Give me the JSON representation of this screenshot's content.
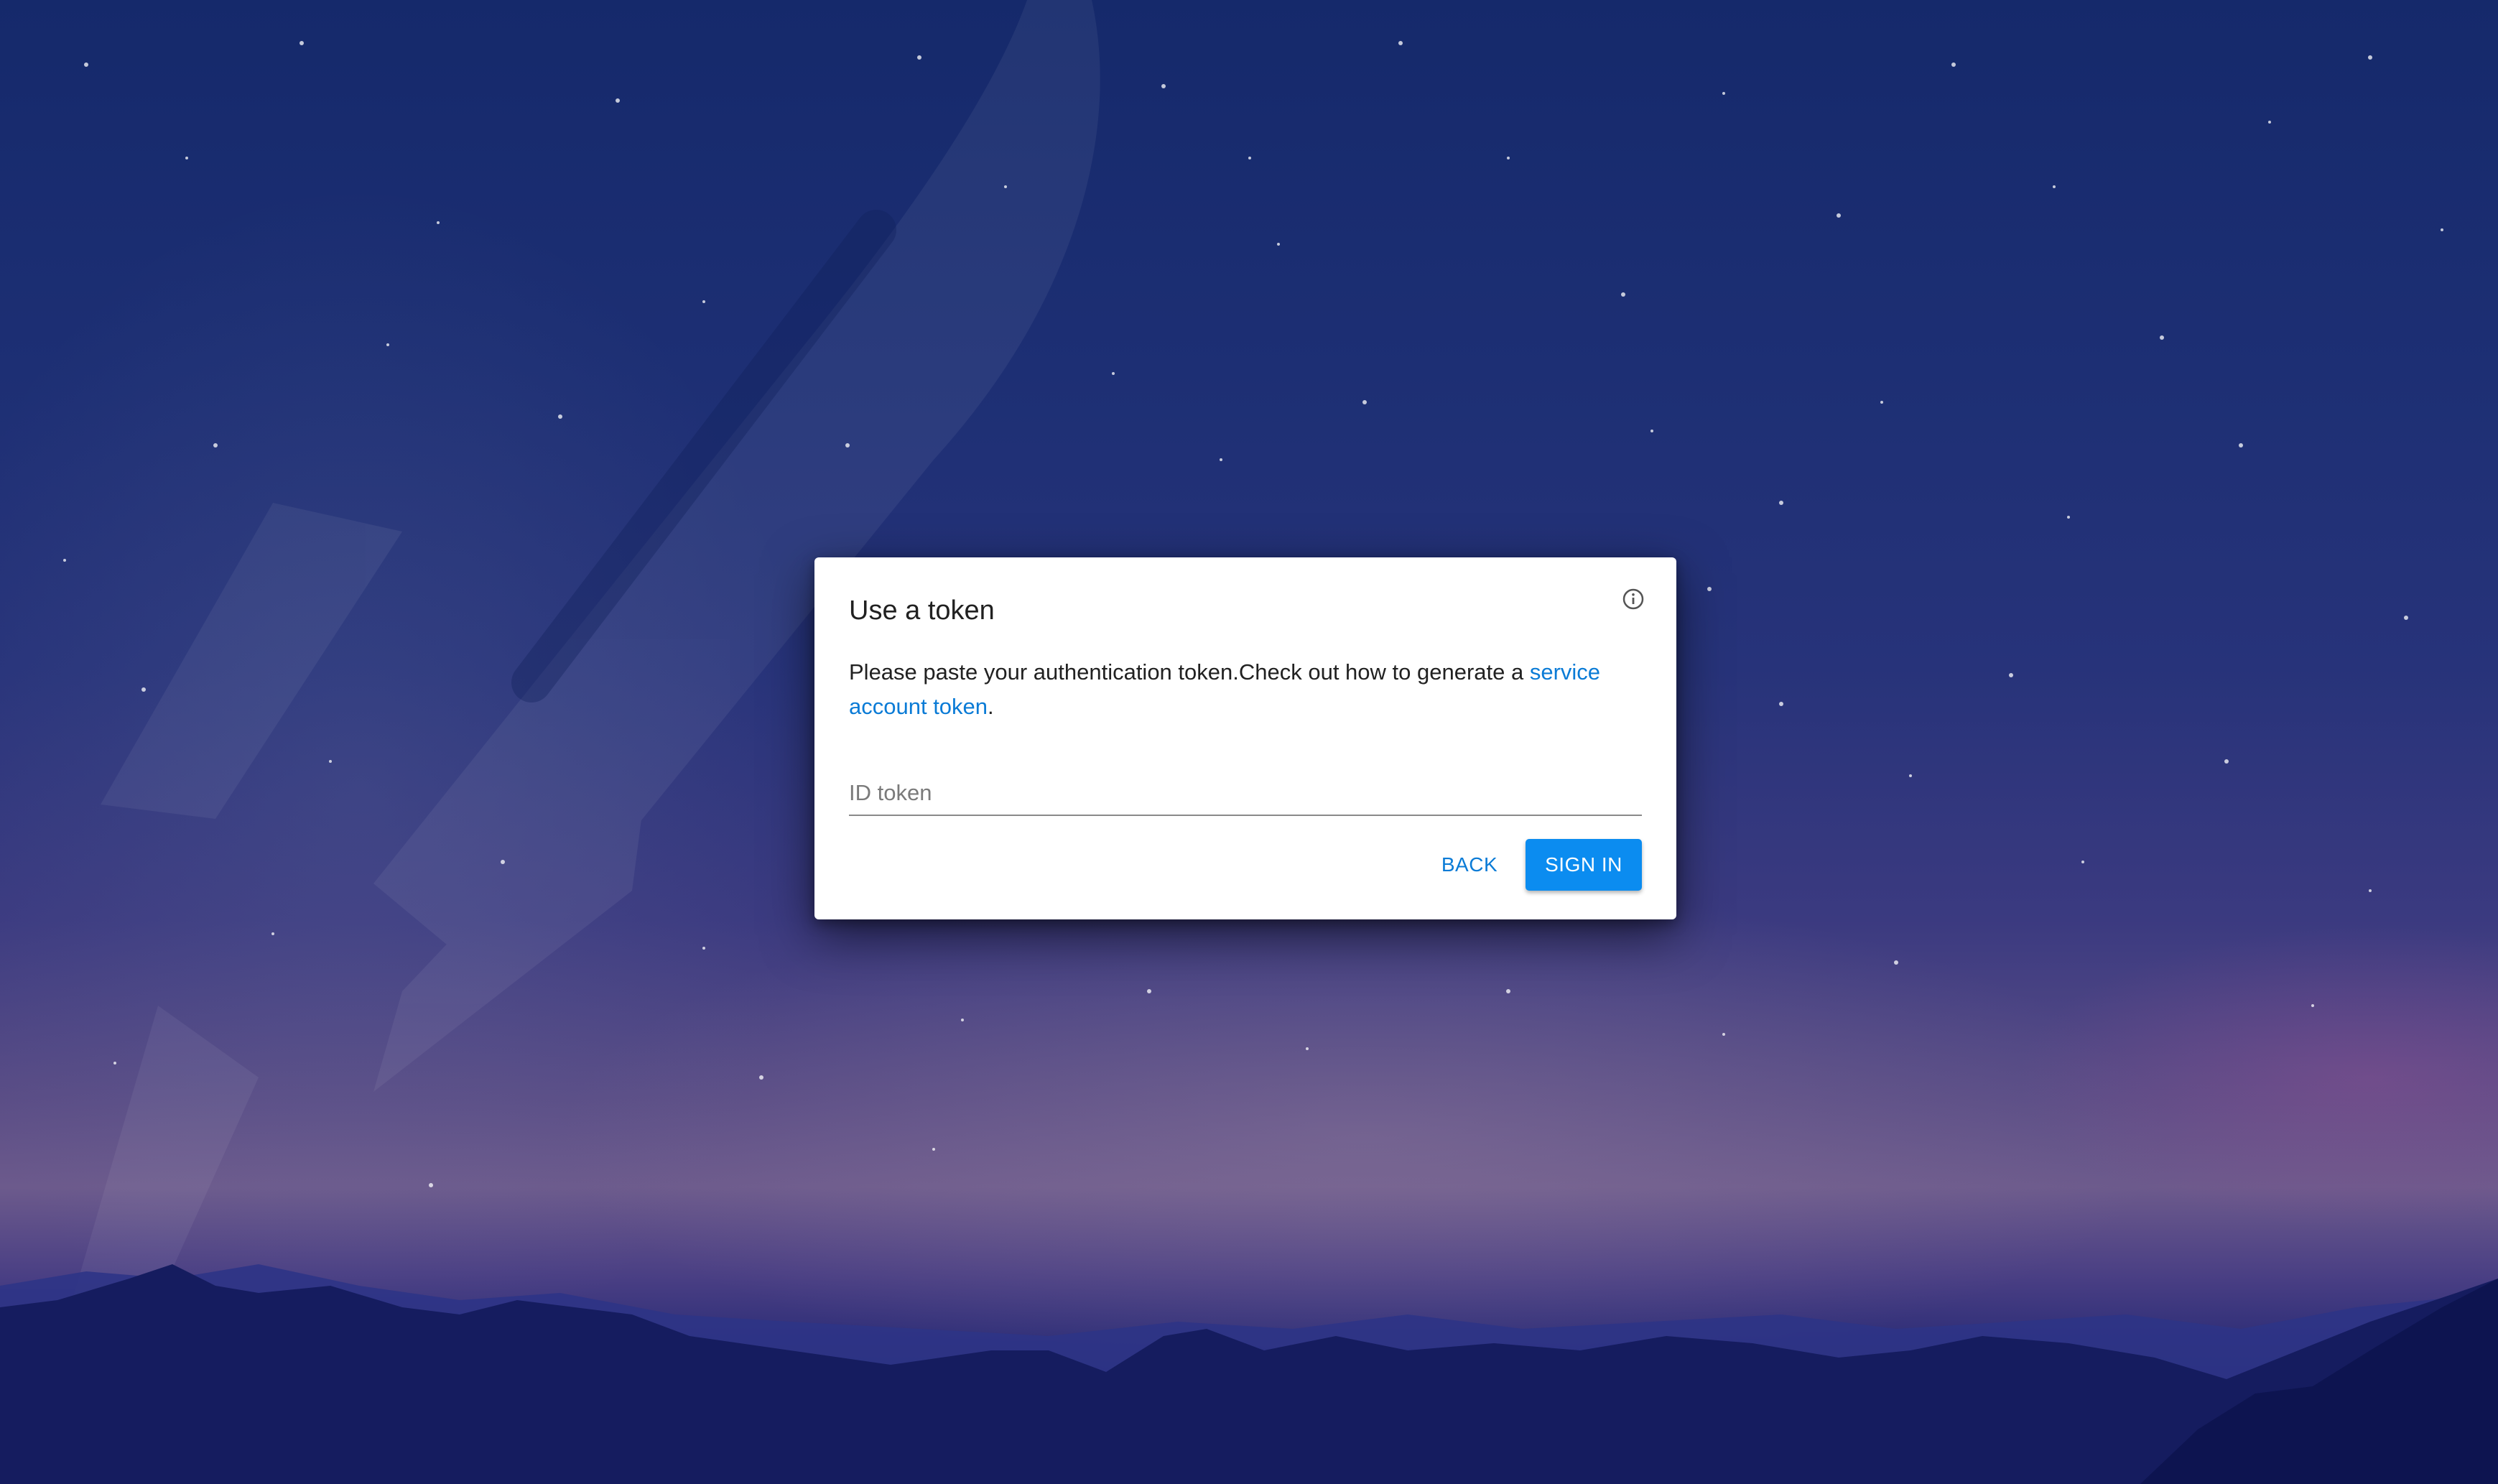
{
  "dialog": {
    "title": "Use a token",
    "description_text": "Please paste your authentication token.Check out how to generate a ",
    "description_link": "service account token",
    "description_suffix": ".",
    "token_placeholder": "ID token",
    "token_value": "",
    "back_label": "BACK",
    "signin_label": "SIGN IN",
    "info_icon": "info-icon"
  },
  "colors": {
    "accent": "#0b8cf0",
    "link": "#0a7bd6",
    "background_top": "#15296b",
    "background_horizon": "#6c5a8c",
    "mountains": "#141c5e"
  }
}
